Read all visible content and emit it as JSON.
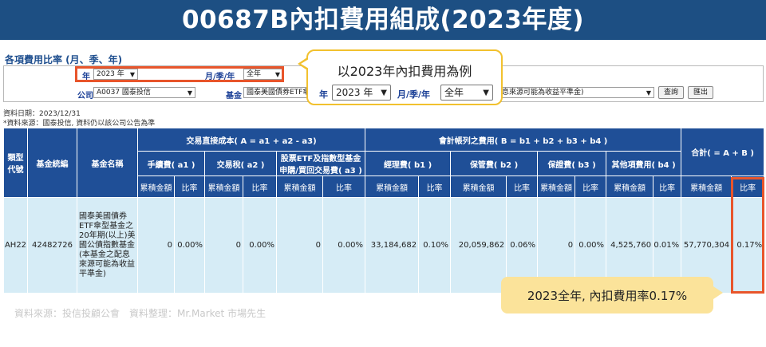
{
  "banner": {
    "title": "00687B內扣費用組成(2023年度)"
  },
  "filter": {
    "section_title": "各項費用比率 (月、季、年)",
    "year_label": "年",
    "year_value": "2023 年",
    "period_label": "月/季/年",
    "period_value": "全年",
    "company_label": "公司",
    "company_value": "A0037 國泰投信",
    "fund_label": "基金",
    "fund_value": "國泰美國債券ETF傘型基金之20年期(以上)美國公債指數基金(本基金之配息來源可能為收益平準金)",
    "fund_value_tail": "息來源可能為收益平準金)",
    "query_button": "查詢",
    "export_button": "匯出"
  },
  "callout_top": {
    "text": "以2023年內扣費用為例",
    "year_label": "年",
    "year_value": "2023 年",
    "period_label": "月/季/年",
    "period_value": "全年"
  },
  "meta": {
    "data_date": "資料日期：2023/12/31",
    "data_source": "*資料來源：國泰投信, 資料仍以該公司公告為準"
  },
  "table": {
    "headers": {
      "type_code": "類型代號",
      "fund_code": "基金統編",
      "fund_name": "基金名稱",
      "group_a": "交易直接成本( A = a1 + a2 - a3)",
      "group_b": "會計帳列之費用( B = b1 + b2 + b3 + b4 )",
      "total": "合計( = A + B )",
      "a1": "手續費( a1 )",
      "a2": "交易稅( a2 )",
      "a3": "股票ETF及指數型基金申購/買回交易費( a3 )",
      "b1": "經理費( b1 )",
      "b2": "保管費( b2 )",
      "b3": "保證費( b3 )",
      "b4": "其他項費用( b4 )",
      "amount": "累積金額",
      "ratio": "比率"
    },
    "row": {
      "type_code": "AH22",
      "fund_code": "42482726",
      "fund_name": "國泰美國債券ETF傘型基金之20年期(以上)美國公債指數基金(本基金之配息來源可能為收益平準金)",
      "a1_amount": "0",
      "a1_ratio": "0.00%",
      "a2_amount": "0",
      "a2_ratio": "0.00%",
      "a3_amount": "0",
      "a3_ratio": "0.00%",
      "b1_amount": "33,184,682",
      "b1_ratio": "0.10%",
      "b2_amount": "20,059,862",
      "b2_ratio": "0.06%",
      "b3_amount": "0",
      "b3_ratio": "0.00%",
      "b4_amount": "4,525,760",
      "b4_ratio": "0.01%",
      "total_amount": "57,770,304",
      "total_ratio": "0.17%"
    }
  },
  "callout_bottom": {
    "text": "2023全年, 內扣費用率0.17%"
  },
  "footer": {
    "source": "資料來源：投信投顧公會　資料整理：Mr.Market 市場先生"
  },
  "colors": {
    "banner": "#1d4f83",
    "header": "#1f4f97",
    "cell": "#d6ecf6",
    "highlight": "#e8552b",
    "callout": "#f2c12e"
  }
}
